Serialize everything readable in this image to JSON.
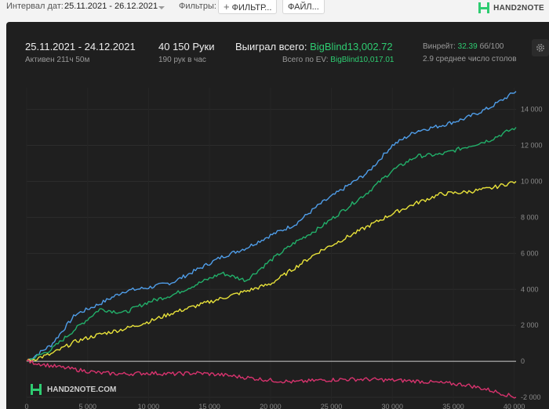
{
  "topbar": {
    "interval_label": "Интервал дат:",
    "interval_value": "25.11.2021 - 26.12.2021",
    "filters_label": "Фильтры:",
    "filter_button": "ФИЛЬТР...",
    "file_button": "ФАЙЛ...",
    "brand": "HAND2NOTE"
  },
  "summary": {
    "period": "25.11.2021 - 24.12.2021",
    "active": "Активен 211ч 50м",
    "hands": "40 150 Руки",
    "hands_per_hour": "190 рук в час",
    "won_label": "Выиграл всего:",
    "won_value": "BigBlind13,002.72",
    "ev_label": "Всего по EV:",
    "ev_value": "BigBlind10,017.01",
    "winrate_label": "Винрейт:",
    "winrate_value": "32.39",
    "winrate_unit": "бб/100",
    "tables": "2.9 среднее число столов"
  },
  "watermark": "HAND2NOTE.COM",
  "colors": {
    "panel": "#1f1f1f",
    "blue": "#4f9de8",
    "green": "#22b06a",
    "yellow": "#e8e23a",
    "red": "#d8336e",
    "accent_green": "#2ecc71"
  },
  "chart_data": {
    "type": "line",
    "xlim": [
      0,
      40150
    ],
    "ylim": [
      -2300,
      15200
    ],
    "x_ticks": [
      0,
      5000,
      10000,
      15000,
      20000,
      25000,
      30000,
      35000,
      40000
    ],
    "x_tick_labels": [
      "0",
      "5 000",
      "10 000",
      "15 000",
      "20 000",
      "25 000",
      "30 000",
      "35 000",
      "40 000"
    ],
    "y_ticks": [
      -2000,
      0,
      2000,
      4000,
      6000,
      8000,
      10000,
      12000,
      14000
    ],
    "y_tick_labels": [
      "-2 000",
      "0",
      "2 000",
      "4 000",
      "6 000",
      "8 000",
      "10 000",
      "12 000",
      "14 000"
    ],
    "grid": true,
    "x": [
      0,
      2000,
      4000,
      6000,
      8000,
      10000,
      12000,
      14000,
      16000,
      18000,
      20000,
      22000,
      24000,
      26000,
      28000,
      30000,
      32000,
      34000,
      36000,
      38000,
      40150
    ],
    "series": [
      {
        "color": "#4f9de8",
        "values": [
          0,
          900,
          2600,
          3200,
          3900,
          4100,
          4400,
          5100,
          5800,
          6300,
          7000,
          7600,
          8700,
          9600,
          10500,
          12000,
          12800,
          13100,
          13500,
          14100,
          15000
        ]
      },
      {
        "color": "#22b06a",
        "values": [
          0,
          650,
          1800,
          2900,
          2700,
          3300,
          3700,
          4300,
          4900,
          4500,
          5600,
          6600,
          7400,
          8400,
          9400,
          10600,
          11400,
          11500,
          11900,
          12300,
          13000
        ]
      },
      {
        "color": "#e8e23a",
        "values": [
          0,
          400,
          1100,
          1500,
          1800,
          2200,
          2700,
          3100,
          3500,
          3900,
          4300,
          5200,
          6100,
          6800,
          7500,
          8200,
          8800,
          9300,
          9400,
          9600,
          10000
        ]
      },
      {
        "color": "#d8336e",
        "values": [
          0,
          -250,
          -450,
          -650,
          -700,
          -650,
          -700,
          -650,
          -750,
          -900,
          -1050,
          -1150,
          -1050,
          -1000,
          -1000,
          -1050,
          -1100,
          -1200,
          -1300,
          -1600,
          -2000
        ]
      }
    ]
  }
}
